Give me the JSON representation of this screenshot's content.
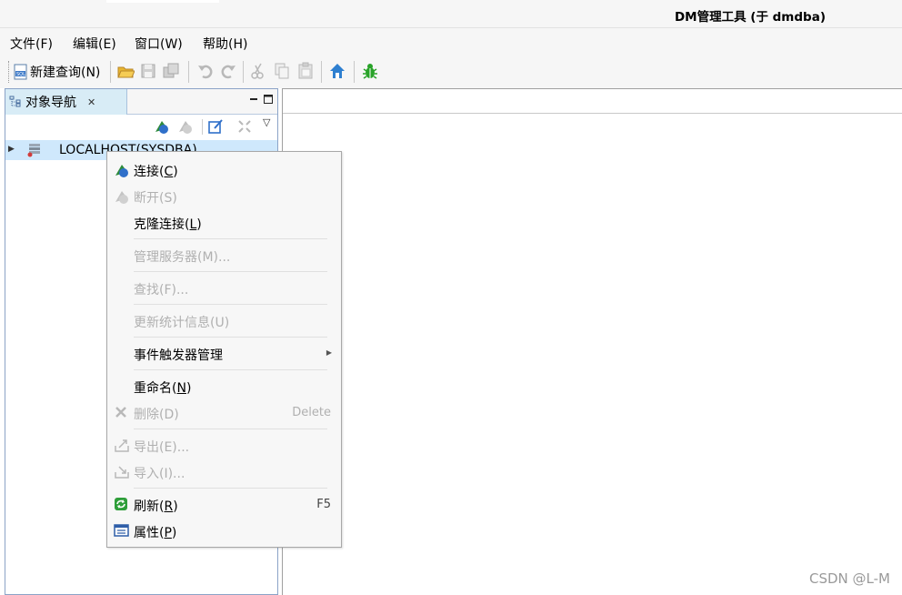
{
  "window": {
    "title": "DM管理工具 (于 dmdba)"
  },
  "menubar": {
    "items": [
      {
        "label": "文件(F)"
      },
      {
        "label": "编辑(E)"
      },
      {
        "label": "窗口(W)"
      },
      {
        "label": "帮助(H)"
      }
    ]
  },
  "toolbar": {
    "new_query_label": "新建查询(N)",
    "icons": [
      "new-query-icon",
      "open-folder-icon",
      "save-icon",
      "save-all-icon",
      "undo-icon",
      "redo-icon",
      "cut-icon",
      "copy-icon",
      "paste-icon",
      "home-icon",
      "debug-icon"
    ]
  },
  "navigator": {
    "tab_label": "对象导航",
    "tree": [
      {
        "label": "LOCALHOST(SYSDBA)",
        "expanded": false,
        "selected": true
      }
    ]
  },
  "context_menu": {
    "items": [
      {
        "id": "connect",
        "label": "连接",
        "mnemonic": "C",
        "icon": "connect-icon",
        "enabled": true
      },
      {
        "id": "disconnect",
        "label": "断开(S)",
        "icon": "disconnect-icon",
        "enabled": false
      },
      {
        "id": "clone",
        "label": "克隆连接",
        "mnemonic": "L",
        "enabled": true
      },
      {
        "id": "manage-server",
        "label": "管理服务器(M)...",
        "enabled": false
      },
      {
        "id": "find",
        "label": "查找(F)...",
        "enabled": false
      },
      {
        "id": "update-stats",
        "label": "更新统计信息(U)",
        "enabled": false
      },
      {
        "id": "event-trigger",
        "label": "事件触发器管理",
        "enabled": true,
        "submenu": true
      },
      {
        "id": "rename",
        "label": "重命名",
        "mnemonic": "N",
        "enabled": true
      },
      {
        "id": "delete",
        "label": "删除(D)",
        "accelerator": "Delete",
        "icon": "delete-icon",
        "enabled": false
      },
      {
        "id": "export",
        "label": "导出(E)...",
        "icon": "export-icon",
        "enabled": false
      },
      {
        "id": "import",
        "label": "导入(I)...",
        "icon": "import-icon",
        "enabled": false
      },
      {
        "id": "refresh",
        "label": "刷新",
        "mnemonic": "R",
        "accelerator": "F5",
        "icon": "refresh-icon",
        "enabled": true
      },
      {
        "id": "properties",
        "label": "属性",
        "mnemonic": "P",
        "icon": "properties-icon",
        "enabled": true
      }
    ]
  },
  "watermark": "CSDN @L-M",
  "colors": {
    "selection": "#cfe8fc",
    "tab_active": "#d8ecf6",
    "menu_bg": "#f7f7f7",
    "disabled_text": "#b0b0b0"
  }
}
